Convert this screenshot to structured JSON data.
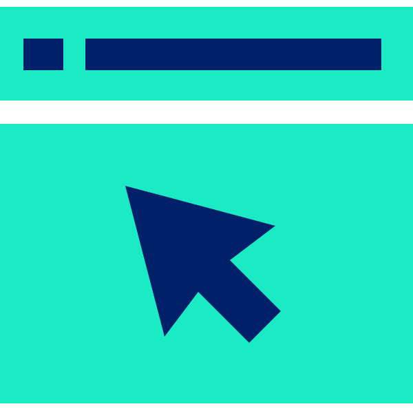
{
  "icon": {
    "name": "browser-window-cursor-icon",
    "colors": {
      "background": "#ffffff",
      "panel": "#1aebc4",
      "accent": "#00206a"
    }
  }
}
